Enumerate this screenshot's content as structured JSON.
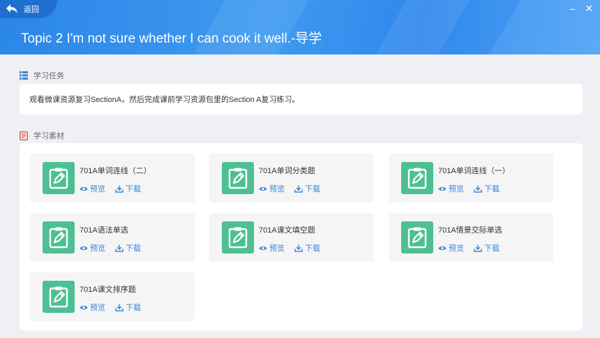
{
  "nav": {
    "back_label": "返回",
    "minimize": "–",
    "close": "✕"
  },
  "page": {
    "title": "Topic 2 I'm not sure whether I can cook it well.-导学"
  },
  "task_section": {
    "label": "学习任务",
    "text": "观看微课资源复习SectionA，然后完成课前学习资源包里的Section A复习练习。"
  },
  "materials_section": {
    "label": "学习素材",
    "preview_label": "预览",
    "download_label": "下载",
    "items": [
      {
        "title": "701A单词连线（二）"
      },
      {
        "title": "701A单词分类题"
      },
      {
        "title": "701A单词连线（一）"
      },
      {
        "title": "701A语法单选"
      },
      {
        "title": "701A课文填空题"
      },
      {
        "title": "701A情景交际单选"
      },
      {
        "title": "701A课文排序题"
      }
    ]
  },
  "colors": {
    "header_blue": "#2f88ec",
    "back_button": "#1f6fd0",
    "icon_green": "#4dbf94",
    "link_blue": "#3a86d6",
    "task_icon": "#3a86d6",
    "materials_icon": "#e2643c"
  }
}
